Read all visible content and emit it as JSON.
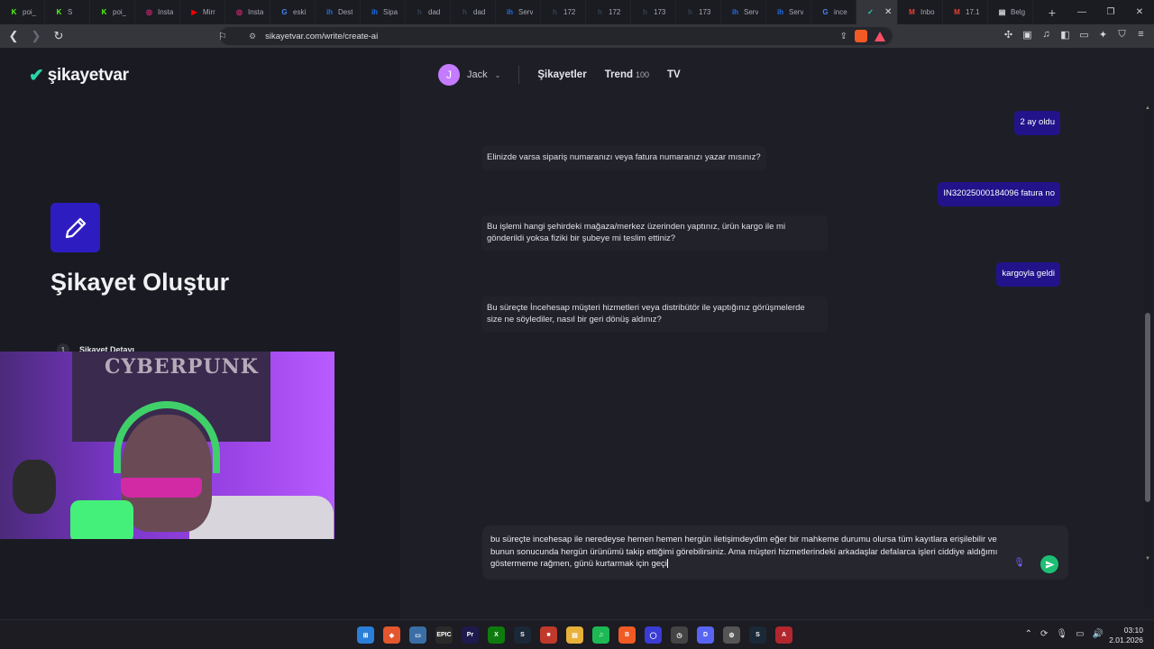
{
  "browser": {
    "tabs": [
      {
        "label": "poi_",
        "fav_text": "K",
        "fav_color": "#53fc18"
      },
      {
        "label": "S",
        "fav_text": "K",
        "fav_color": "#53fc18"
      },
      {
        "label": "poi_",
        "fav_text": "K",
        "fav_color": "#53fc18"
      },
      {
        "label": "Insta",
        "fav_text": "◎",
        "fav_color": "#dd2a7b"
      },
      {
        "label": "Mirr",
        "fav_text": "▶",
        "fav_color": "#ff0000"
      },
      {
        "label": "Insta",
        "fav_text": "◎",
        "fav_color": "#dd2a7b"
      },
      {
        "label": "eski",
        "fav_text": "G",
        "fav_color": "#4285f4"
      },
      {
        "label": "Dest",
        "fav_text": "ih",
        "fav_color": "#1f6feb"
      },
      {
        "label": "Sipa",
        "fav_text": "ih",
        "fav_color": "#1f6feb"
      },
      {
        "label": "dad",
        "fav_text": "h",
        "fav_color": "#334155"
      },
      {
        "label": "dad",
        "fav_text": "h",
        "fav_color": "#334155"
      },
      {
        "label": "Serv",
        "fav_text": "ih",
        "fav_color": "#1f6feb"
      },
      {
        "label": "172",
        "fav_text": "h",
        "fav_color": "#334155"
      },
      {
        "label": "172",
        "fav_text": "h",
        "fav_color": "#334155"
      },
      {
        "label": "173",
        "fav_text": "h",
        "fav_color": "#334155"
      },
      {
        "label": "173",
        "fav_text": "h",
        "fav_color": "#334155"
      },
      {
        "label": "Serv",
        "fav_text": "ih",
        "fav_color": "#1f6feb"
      },
      {
        "label": "Serv",
        "fav_text": "ih",
        "fav_color": "#1f6feb"
      },
      {
        "label": "ince",
        "fav_text": "G",
        "fav_color": "#4285f4"
      },
      {
        "label": "",
        "fav_text": "✓",
        "fav_color": "#2ad6a8",
        "active": true
      },
      {
        "label": "Inbo",
        "fav_text": "M",
        "fav_color": "#ea4335"
      },
      {
        "label": "17.1",
        "fav_text": "M",
        "fav_color": "#ea4335"
      },
      {
        "label": "Belg",
        "fav_text": "▤",
        "fav_color": "#e8e8e8"
      }
    ],
    "url": "sikayetvar.com/write/create-ai"
  },
  "site": {
    "logo": "şikayetvar",
    "page_title": "Şikayet Oluştur",
    "step_number": "1",
    "step_label": "Şikayet Detayı",
    "user": {
      "initial": "J",
      "name": "Jack"
    },
    "nav": {
      "complaints": "Şikayetler",
      "trend": "Trend",
      "trend_count": "100",
      "tv": "TV"
    }
  },
  "chat": {
    "messages": [
      {
        "role": "user",
        "text": "2 ay oldu"
      },
      {
        "role": "bot",
        "text": "Elinizde varsa sipariş numaranızı veya fatura numaranızı yazar mısınız?"
      },
      {
        "role": "user",
        "text": "IN32025000184096 fatura no"
      },
      {
        "role": "bot",
        "text": "Bu işlemi hangi şehirdeki mağaza/merkez üzerinden yaptınız, ürün kargo ile mi gönderildi yoksa fiziki bir şubeye mi teslim ettiniz?"
      },
      {
        "role": "user",
        "text": "kargoyla geldi"
      },
      {
        "role": "bot",
        "text": "Bu süreçte İncehesap müşteri hizmetleri veya distribütör ile yaptığınız görüşmelerde size ne söylediler, nasıl bir geri dönüş aldınız?"
      }
    ],
    "draft": "bu süreçte incehesap ile neredeyse hemen hemen hergün iletişimdeydim eğer bir mahkeme durumu olursa tüm kayıtlara erişilebilir ve bunun sonucunda hergün ürünümü takip ettiğimi görebilirsiniz. Ama müşteri hizmetlerindeki arkadaşlar defalarca işleri ciddiye aldığımı göstermeme rağmen, günü kurtarmak için geçi"
  },
  "webcam": {
    "poster_text": "CYBERPUNK"
  },
  "taskbar": {
    "icons": [
      {
        "name": "start",
        "color": "#2b7fd8",
        "glyph": "⊞"
      },
      {
        "name": "app-orange",
        "color": "#e4572e",
        "glyph": "◆"
      },
      {
        "name": "app-monitor",
        "color": "#3a6ea5",
        "glyph": "▭"
      },
      {
        "name": "epic-games",
        "color": "#2a2a2a",
        "glyph": "EPIC"
      },
      {
        "name": "premiere-pro",
        "color": "#1e1a4d",
        "glyph": "Pr"
      },
      {
        "name": "xbox",
        "color": "#0f7b0f",
        "glyph": "X"
      },
      {
        "name": "steam",
        "color": "#1b2838",
        "glyph": "S"
      },
      {
        "name": "app-red",
        "color": "#c0392b",
        "glyph": "■"
      },
      {
        "name": "file-explorer",
        "color": "#e8b13a",
        "glyph": "▤"
      },
      {
        "name": "spotify",
        "color": "#1db954",
        "glyph": "♫"
      },
      {
        "name": "brave",
        "color": "#f15a24",
        "glyph": "B"
      },
      {
        "name": "app-circle",
        "color": "#3b3bd6",
        "glyph": "◯"
      },
      {
        "name": "app-clock",
        "color": "#444",
        "glyph": "◷"
      },
      {
        "name": "discord",
        "color": "#5865f2",
        "glyph": "D"
      },
      {
        "name": "settings",
        "color": "#555",
        "glyph": "⚙"
      },
      {
        "name": "steam-2",
        "color": "#1b2838",
        "glyph": "S"
      },
      {
        "name": "app-red-2",
        "color": "#b3262e",
        "glyph": "A"
      }
    ],
    "time": "03:10",
    "date": "2.01.2026"
  }
}
